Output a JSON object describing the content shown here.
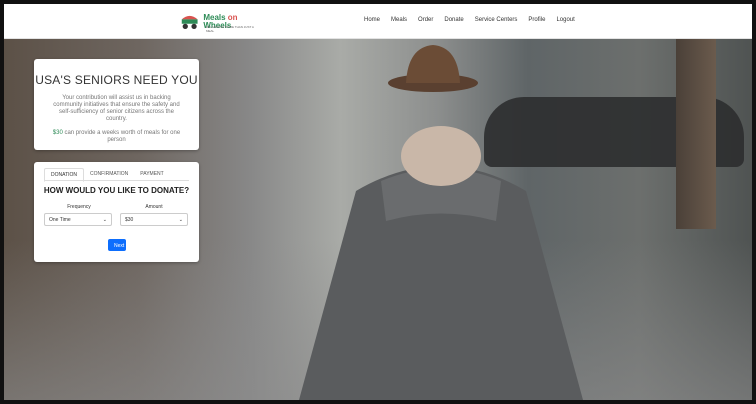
{
  "brand": {
    "name_part1": "Meals",
    "name_part2": "on",
    "name_part3": "Wheels",
    "tagline": "DELIVERING MORE THAN JUST A MEAL"
  },
  "nav": {
    "items": [
      "Home",
      "Meals",
      "Order",
      "Donate",
      "Service Centers",
      "Profile",
      "Logout"
    ]
  },
  "intro": {
    "heading": "USA'S SENIORS NEED YOU",
    "body": "Your contribution will assist us in backing community initiatives that ensure the safety and self-sufficiency of senior citizens across the country.",
    "amount": "$30",
    "impact": "can provide a weeks worth of meals for one person"
  },
  "donation": {
    "tabs": [
      "DONATION",
      "CONFIRMATION",
      "PAYMENT"
    ],
    "heading": "HOW WOULD YOU LIKE TO DONATE?",
    "frequency_label": "Frequency",
    "frequency_value": "One Time",
    "amount_label": "Amount",
    "amount_value": "$30",
    "next_label": "Next"
  },
  "colors": {
    "accent_green": "#2e8b57",
    "accent_red": "#d9534f",
    "button_blue": "#0d6efd"
  }
}
